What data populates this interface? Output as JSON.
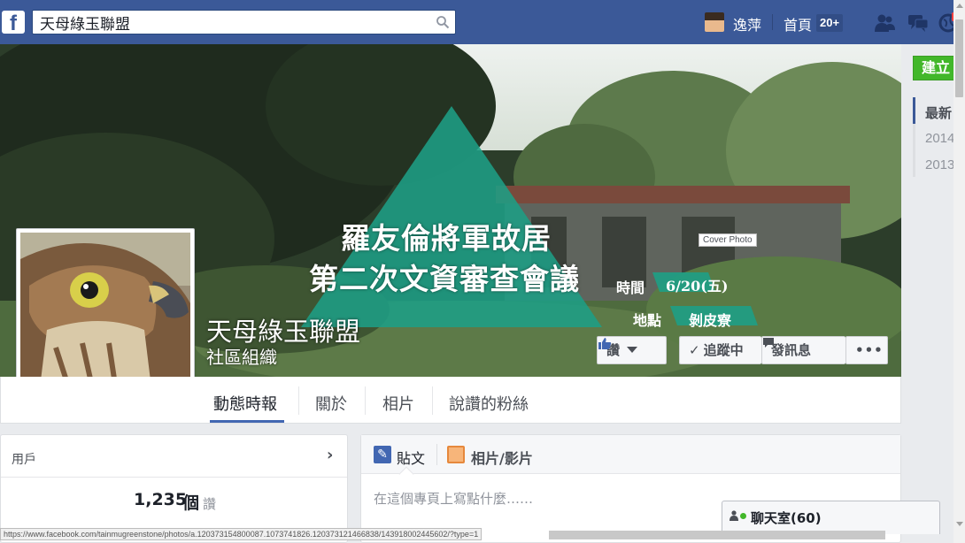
{
  "header": {
    "search_value": "天母綠玉聯盟",
    "user_name": "逸萍",
    "home_label": "首頁",
    "home_badge": "20+"
  },
  "cover": {
    "event_title_line1": "羅友倫將軍故居",
    "event_title_line2": "第二次文資審查會議",
    "time_label": "時間",
    "date": "6/20(五)",
    "place_label": "地點",
    "place": "剝皮寮",
    "cover_photo_tag": "Cover Photo"
  },
  "page": {
    "name": "天母綠玉聯盟",
    "category": "社區組織"
  },
  "actions": {
    "like_label": "讚",
    "following_label": "追蹤中",
    "message_label": "發訊息",
    "more_label": "•••"
  },
  "nav": {
    "tabs": [
      "動態時報",
      "關於",
      "相片",
      "說讚的粉絲"
    ]
  },
  "users_card": {
    "title": "用戶",
    "likes_count": "1,235",
    "likes_unit": "個",
    "likes_suffix": "讚"
  },
  "composer": {
    "status_label": "貼文",
    "photo_label": "相片/影片",
    "placeholder": "在這個專頁上寫點什麼……"
  },
  "sidebar": {
    "create_label": "建立",
    "years": [
      "最新",
      "2014",
      "2013"
    ]
  },
  "chat": {
    "label": "聊天室(60)"
  },
  "status_url": "https://www.facebook.com/tainmugreenstone/photos/a.120373154800087.1073741826.120373121466838/143918002445602/?type=1",
  "colors": {
    "topbar": "#3b5998",
    "create_button": "#42b72a",
    "event_triangle": "#1e9e85"
  }
}
